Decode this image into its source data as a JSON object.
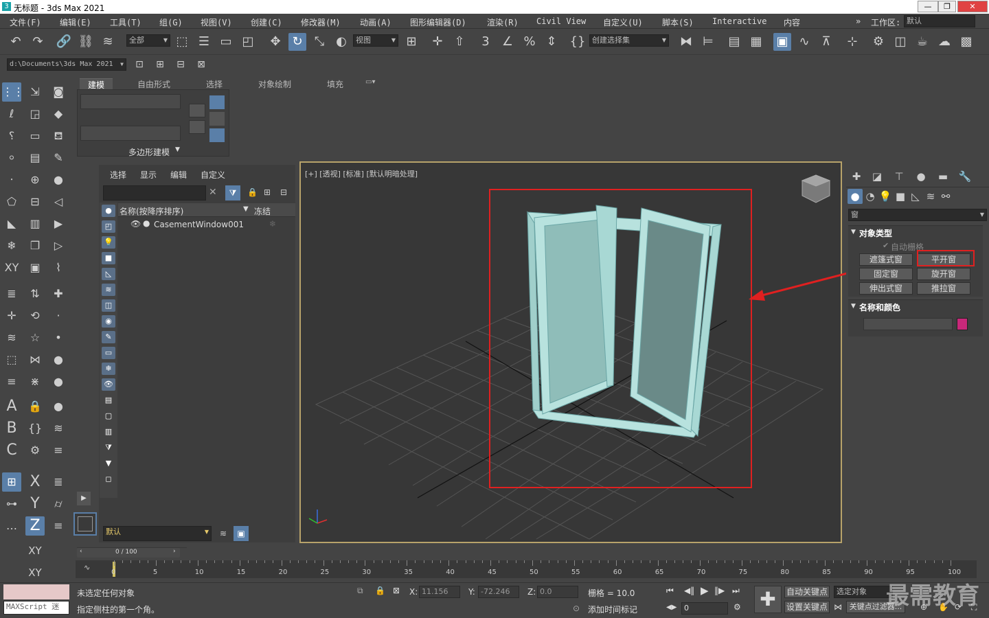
{
  "title_bar": {
    "title": "无标题 - 3ds Max 2021",
    "app_icon": "3",
    "buttons": [
      "—",
      "❐",
      "✕"
    ]
  },
  "menu": [
    "文件(F)",
    "编辑(E)",
    "工具(T)",
    "组(G)",
    "视图(V)",
    "创建(C)",
    "修改器(M)",
    "动画(A)",
    "图形编辑器(D)",
    "渲染(R)",
    "Civil View",
    "自定义(U)",
    "脚本(S)",
    "Interactive",
    "内容"
  ],
  "workspace": {
    "label": "工作区:",
    "value": "默认"
  },
  "toolbar": {
    "selection_filter": "全部",
    "reference_coord": "视图",
    "named_selection": "创建选择集",
    "project_path": "d:\\Documents\\3ds Max 2021"
  },
  "ribbon": {
    "tabs": [
      "建模",
      "自由形式",
      "选择",
      "对象绘制",
      "填充"
    ],
    "active_tab": "建模",
    "group_label": "多边形建模"
  },
  "scene_explorer": {
    "tabs": [
      "选择",
      "显示",
      "编辑",
      "自定义"
    ],
    "col_name": "名称(按降序排序)",
    "col_freeze": "冻结",
    "items": [
      {
        "name": "CasementWindow001"
      }
    ],
    "layer": "默认",
    "scroll": "0 / 100"
  },
  "viewport": {
    "label": "[+] [透视] [标准] [默认明暗处理]"
  },
  "command_panel": {
    "category": "窗",
    "object_type_title": "对象类型",
    "auto_grid": "自动栅格",
    "buttons": [
      "遮篷式窗",
      "平开窗",
      "固定窗",
      "旋开窗",
      "伸出式窗",
      "推拉窗"
    ],
    "highlighted_button": "平开窗",
    "name_color_title": "名称和颜色",
    "object_color": "#c8287a"
  },
  "timeline": {
    "ticks": [
      0,
      5,
      10,
      15,
      20,
      25,
      30,
      35,
      40,
      45,
      50,
      55,
      60,
      65,
      70,
      75,
      80,
      85,
      90,
      95,
      100
    ],
    "slider": "0 / 100"
  },
  "status_bar": {
    "script_label": "MAXScript 迷",
    "line1": "未选定任何对象",
    "line2": "指定侧柱的第一个角。",
    "x_label": "X:",
    "x_value": "11.156",
    "y_label": "Y:",
    "y_value": "-72.246",
    "z_label": "Z:",
    "z_value": "0.0",
    "grid": "栅格 = 10.0",
    "add_time_tag": "添加时间标记",
    "auto_key": "自动关键点",
    "selected_obj": "选定对象",
    "set_key": "设置关键点",
    "key_filter": "关键点过滤器...",
    "frame": "0"
  },
  "watermark": "最需教育",
  "colors": {
    "accent": "#5a7fa8",
    "highlight": "#e02020",
    "viewport_border": "#b8a36a"
  }
}
